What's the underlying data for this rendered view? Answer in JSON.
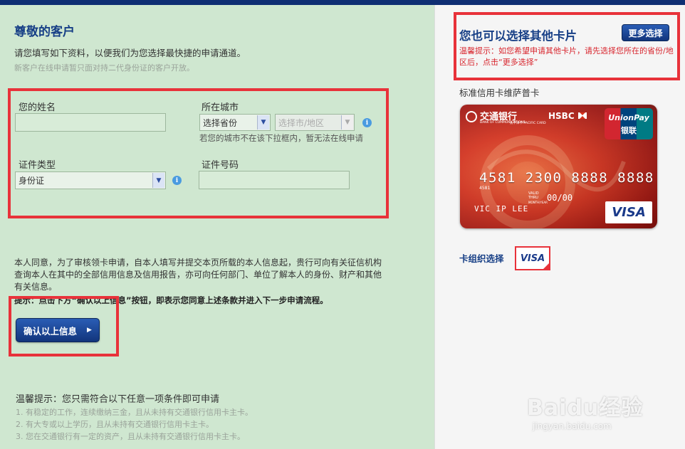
{
  "header": {
    "title": "尊敬的客户",
    "subtitle": "请您填写如下资料，以便我们为您选择最快捷的申请通道。",
    "note": "新客户在线申请暂只面对持二代身份证的客户开放。"
  },
  "form": {
    "name_label": "您的姓名",
    "city_label": "所在城市",
    "province_select": "选择省份",
    "city_select": "选择市/地区",
    "city_hint": "若您的城市不在该下拉框内，暂无法在线申请",
    "id_type_label": "证件类型",
    "id_type_select": "身份证",
    "id_number_label": "证件号码"
  },
  "agreement": {
    "text": "本人同意，为了审核领卡申请，自本人填写并提交本页所载的本人信息起，贵行可向有关征信机构查询本人在其中的全部信用信息及信用报告，亦可向任何部门、单位了解本人的身份、财产和其他有关信息。",
    "tip": "提示：点击下方“确认以上信息”按钮，即表示您同意上述条款并进入下一步申请流程。",
    "confirm_label": "确认以上信息"
  },
  "conditions": {
    "title": "温馨提示：您只需符合以下任意一项条件即可申请",
    "items": [
      "1. 有稳定的工作，连续缴纳三金，且从未持有交通银行信用卡主卡。",
      "2. 有大专或以上学历，且从未持有交通银行信用卡主卡。",
      "3. 您在交通银行有一定的资产，且从未持有交通银行信用卡主卡。"
    ]
  },
  "sidebar": {
    "title": "您也可以选择其他卡片",
    "more_label": "更多选择",
    "warning": "温馨提示：如您希望申请其他卡片，请先选择您所在的省份/地区后，点击“更多选择”",
    "card_name": "标准信用卡维萨普卡",
    "org_label": "卡组织选择",
    "org_visa": "VISA"
  },
  "card": {
    "bank_cn": "交通银行",
    "bank_en": "BANK OF COMMUNICATIONS",
    "pacific": "太平洋卡 PACIFIC CARD",
    "hsbc": "HSBC",
    "unionpay_en": "UnionPay",
    "unionpay_cn": "银联",
    "number": "4581 2300 8888 8888",
    "bin": "4581",
    "valid_label": "VALID THRU",
    "month_year": "MONTH/YEAR",
    "expiry": "00/00",
    "holder": "VIC IP LEE",
    "visa": "VISA"
  },
  "watermark": {
    "brand": "Baidu经验",
    "url": "jingyan.baidu.com"
  },
  "colors": {
    "accent": "#173f86",
    "warning": "#d8262e",
    "highlight": "#e8323a",
    "background": "#cfe7d0"
  }
}
